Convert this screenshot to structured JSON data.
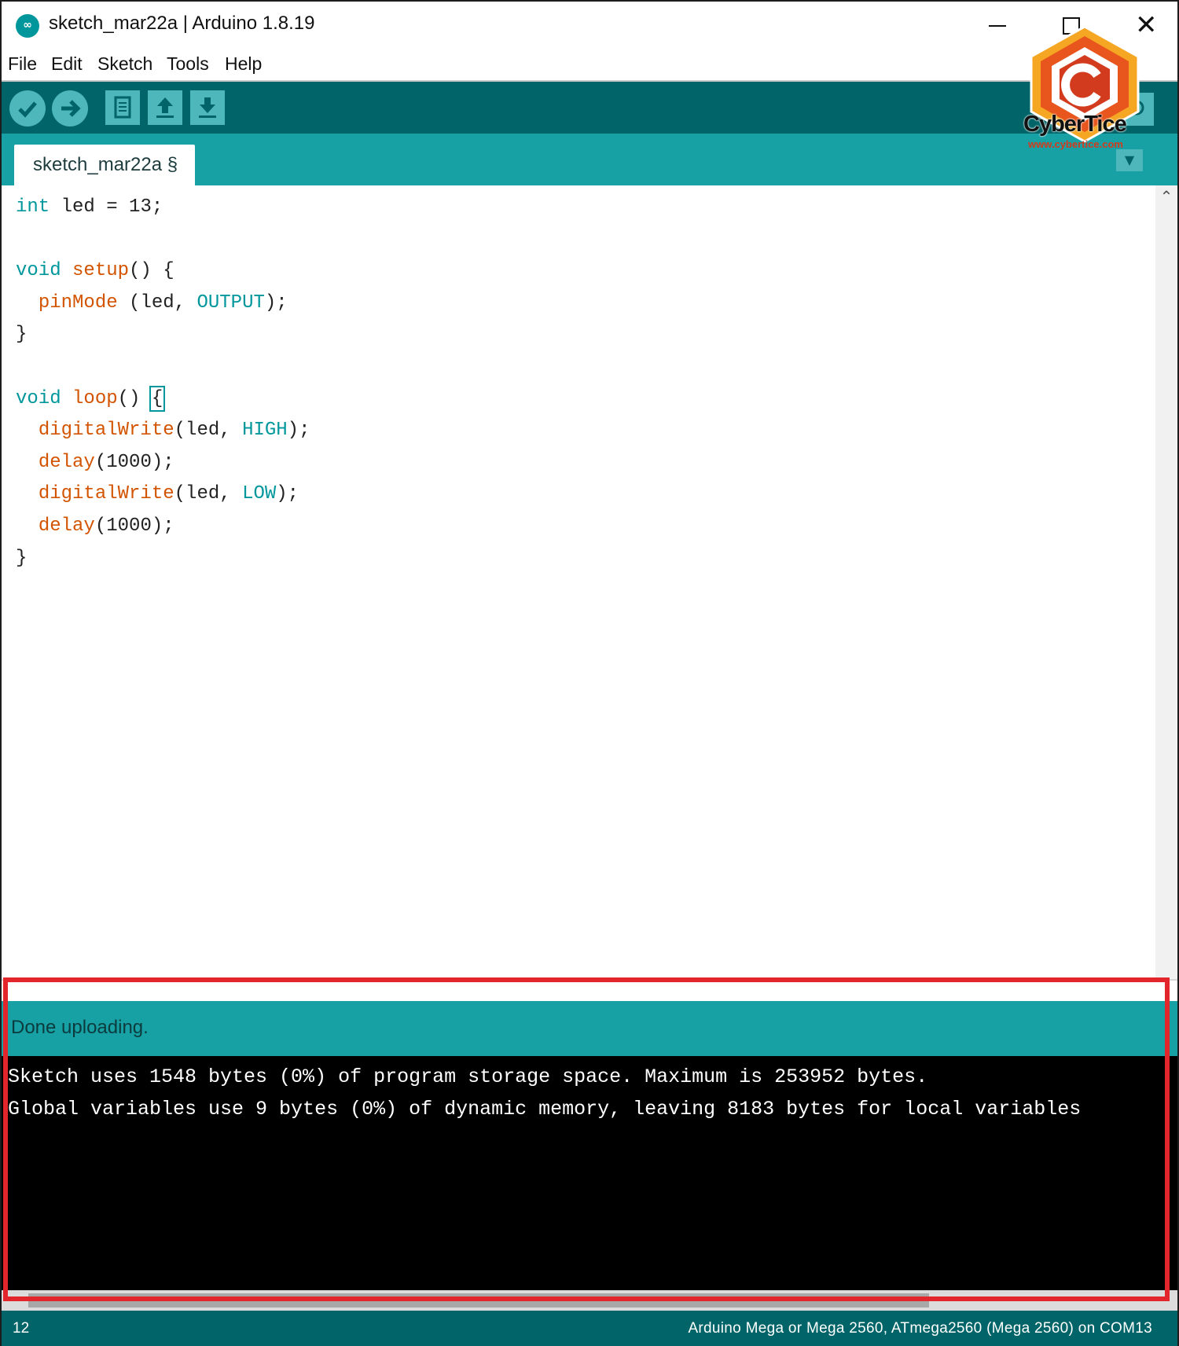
{
  "window": {
    "title": "sketch_mar22a | Arduino 1.8.19",
    "app_icon": "arduino-infinity-icon"
  },
  "menu": [
    "File",
    "Edit",
    "Sketch",
    "Tools",
    "Help"
  ],
  "toolbar": {
    "buttons": [
      "verify-icon",
      "upload-icon",
      "new-icon",
      "open-icon",
      "save-icon"
    ],
    "serial_monitor": "serial-monitor-icon"
  },
  "tab": {
    "label": "sketch_mar22a §"
  },
  "watermark": {
    "name": "CyberTice",
    "url": "www.cybertice.com"
  },
  "code": {
    "l1_kw": "int",
    "l1_rest": " led = 13;",
    "l3_kw": "void",
    "l3_fn": "setup",
    "l3_rest": "() {",
    "l4_fn": "pinMode",
    "l4_a": " (led, ",
    "l4_const": "OUTPUT",
    "l4_b": ");",
    "l5": "}",
    "l7_kw": "void",
    "l7_fn": "loop",
    "l7_rest": "() ",
    "l7_brace": "{",
    "l8_fn": "digitalWrite",
    "l8_a": "(led, ",
    "l8_const": "HIGH",
    "l8_b": ");",
    "l9_fn": "delay",
    "l9_a": "(1000);",
    "l10_fn": "digitalWrite",
    "l10_a": "(led, ",
    "l10_const": "LOW",
    "l10_b": ");",
    "l11_fn": "delay",
    "l11_a": "(1000);",
    "l12": "}"
  },
  "status": {
    "message": "Done uploading."
  },
  "console": {
    "lines": [
      "Sketch uses 1548 bytes (0%) of program storage space. Maximum is 253952 bytes.",
      "Global variables use 9 bytes (0%) of dynamic memory, leaving 8183 bytes for local variables"
    ]
  },
  "footer": {
    "line_number": "12",
    "board": "Arduino Mega or Mega 2560, ATmega2560 (Mega 2560) on COM13"
  },
  "colors": {
    "toolbar": "#006468",
    "accent": "#17a1a5",
    "keyword": "#00979c",
    "function": "#d35400",
    "highlight_box": "#e3262c"
  }
}
